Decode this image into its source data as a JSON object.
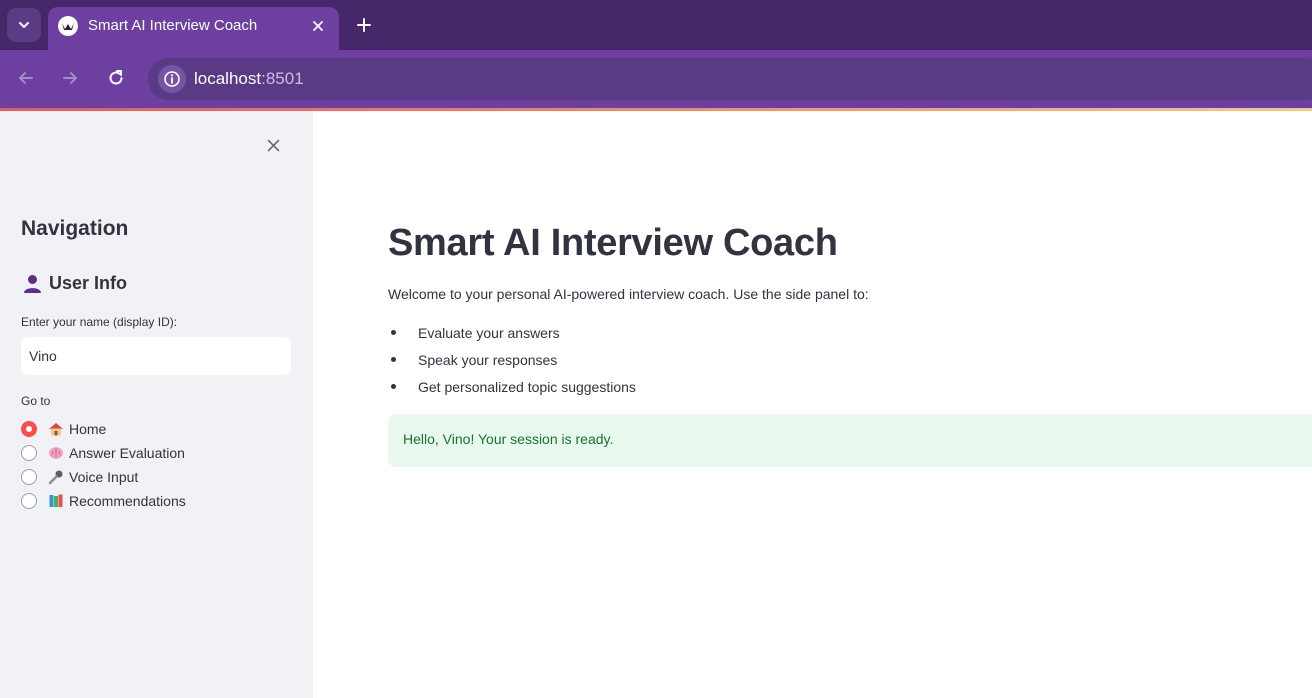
{
  "browser": {
    "tab_title": "Smart AI Interview Coach",
    "url_host": "localhost",
    "url_port": ":8501",
    "accent_color": "#6c3fa0"
  },
  "sidebar": {
    "navigation_heading": "Navigation",
    "user_info_heading": "User Info",
    "name_label": "Enter your name (display ID):",
    "name_value": "Vino",
    "goto_label": "Go to",
    "options": [
      {
        "emoji": "house-icon",
        "label": "Home",
        "selected": true
      },
      {
        "emoji": "brain-icon",
        "label": "Answer Evaluation",
        "selected": false
      },
      {
        "emoji": "microphone-icon",
        "label": "Voice Input",
        "selected": false
      },
      {
        "emoji": "books-icon",
        "label": "Recommendations",
        "selected": false
      }
    ]
  },
  "main": {
    "title": "Smart AI Interview Coach",
    "intro": "Welcome to your personal AI-powered interview coach. Use the side panel to:",
    "bullets": [
      "Evaluate your answers",
      "Speak your responses",
      "Get personalized topic suggestions"
    ],
    "success_message": "Hello, Vino! Your session is ready.",
    "success_color": "#177233"
  }
}
